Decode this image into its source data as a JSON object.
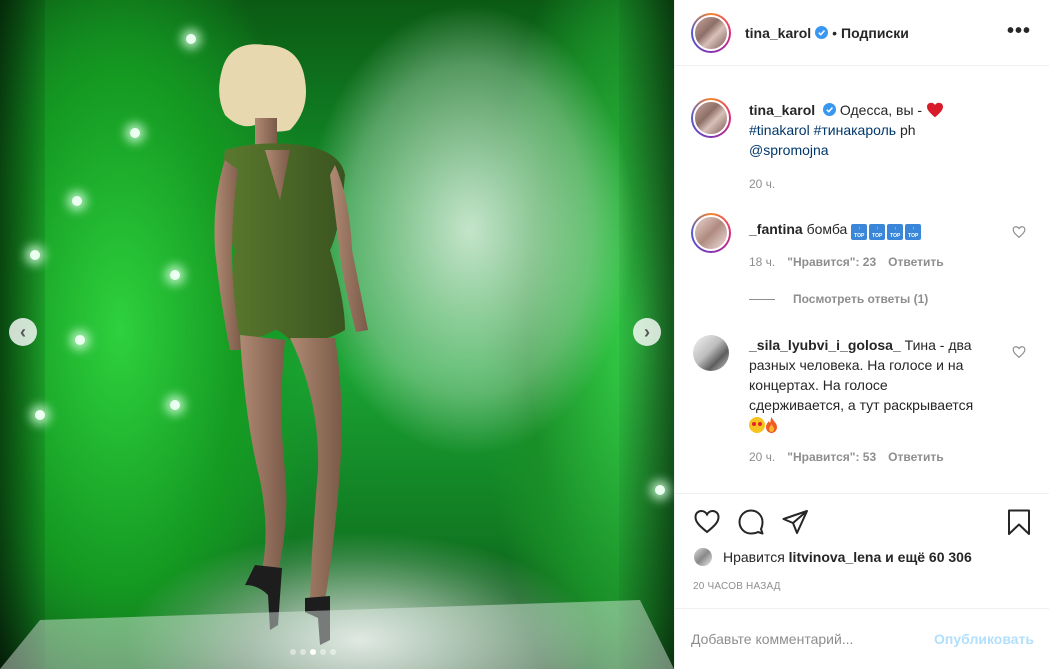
{
  "post": {
    "author": "tina_karol",
    "separator": "•",
    "follow_label": "Подписки",
    "more_icon": "more-horizontal-icon",
    "slides": {
      "count": 5,
      "active": 2
    }
  },
  "caption": {
    "username": "tina_karol",
    "text": "Одесса, вы - ",
    "hashtags": "#tinakarol #тинакароль",
    "suffix": " ph",
    "mention": "@spromojna",
    "time": "20 ч."
  },
  "comments": [
    {
      "username": "_fantina",
      "text": "бомба",
      "time": "18 ч.",
      "likes": "\"Нравится\": 23",
      "reply_label": "Ответить"
    },
    {
      "username": "_sila_lyubvi_i_golosa_",
      "text": "Тина - два разных человека. На голосе и на концертах. На голосе сдерживается, а тут раскрывается",
      "time": "20 ч.",
      "likes": "\"Нравится\": 53",
      "reply_label": "Ответить"
    }
  ],
  "view_replies": "Посмотреть ответы (1)",
  "likes": {
    "prefix": "Нравится",
    "user": "litvinova_lena",
    "rest": "и ещё 60 306"
  },
  "timestamp": "20 ЧАСОВ НАЗАД",
  "comment_box": {
    "placeholder": "Добавьте комментарий...",
    "publish_label": "Опубликовать"
  },
  "colors": {
    "link": "#00376b",
    "muted": "#8e8e8e",
    "publish_disabled": "#b2dffc",
    "verified": "#3897f0",
    "heart": "#ed4956"
  }
}
